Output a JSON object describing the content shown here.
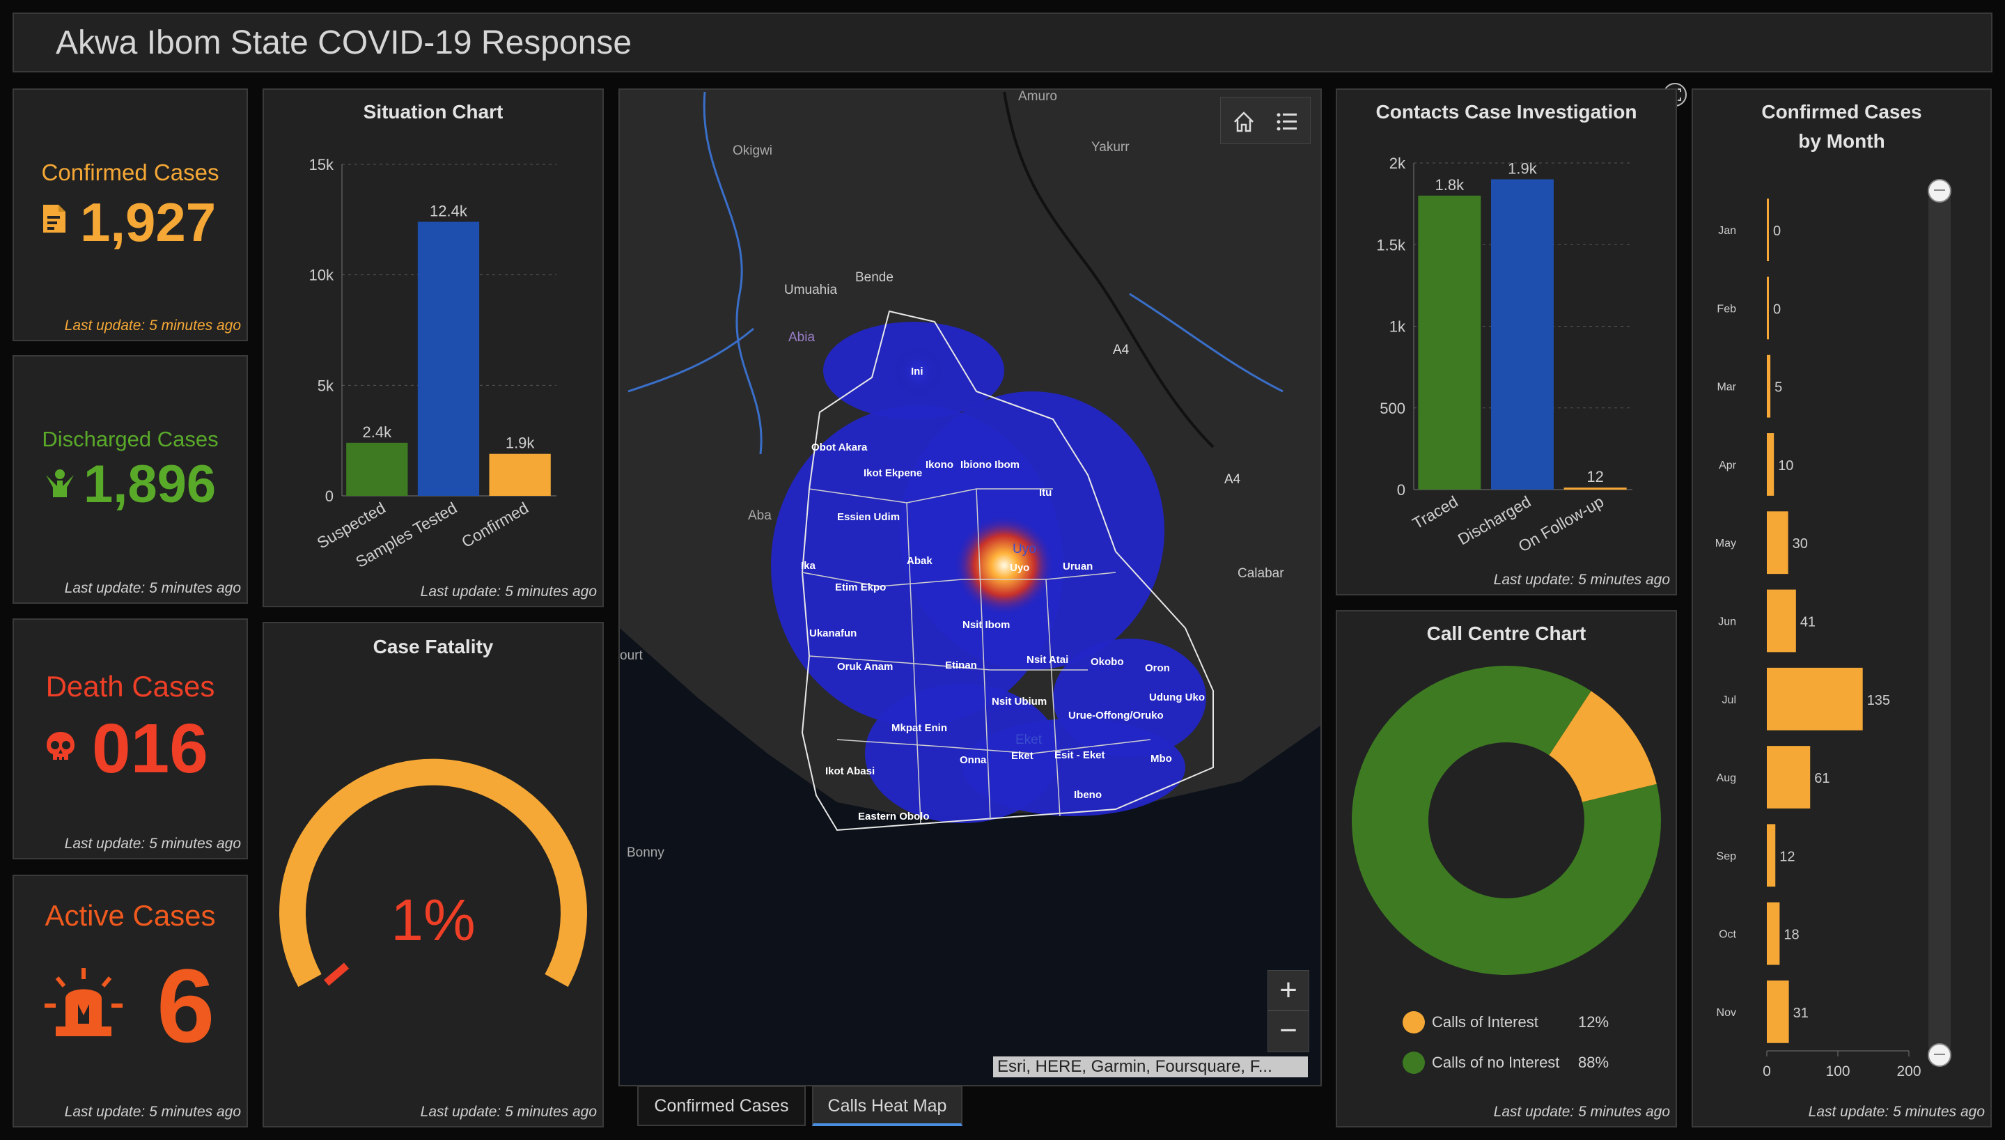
{
  "header": {
    "title": "Akwa Ibom State COVID-19 Response"
  },
  "cards": {
    "confirmed": {
      "label": "Confirmed Cases",
      "value": "1,927",
      "update": "Last update: 5 minutes ago",
      "color": "#f5a836",
      "icon": "document-icon"
    },
    "discharged": {
      "label": "Discharged Cases",
      "value": "1,896",
      "update": "Last update: 5 minutes ago",
      "color": "#5aaa2a",
      "icon": "people-icon"
    },
    "death": {
      "label": "Death Cases",
      "value": "016",
      "update": "Last update: 5 minutes ago",
      "color": "#ef3f26",
      "icon": "skull-icon"
    },
    "active": {
      "label": "Active Cases",
      "value": "6",
      "update": "Last update: 5 minutes ago",
      "color": "#f05a1e",
      "icon": "siren-icon"
    }
  },
  "situation": {
    "title": "Situation Chart",
    "update": "Last update: 5 minutes ago",
    "chart_data": {
      "type": "bar",
      "categories": [
        "Suspected",
        "Samples Tested",
        "Confirmed"
      ],
      "values": [
        2400,
        12400,
        1900
      ],
      "value_labels": [
        "2.4k",
        "12.4k",
        "1.9k"
      ],
      "colors": [
        "#3d7a22",
        "#1f4fae",
        "#f5a836"
      ],
      "yticks": [
        "15k",
        "10k",
        "5k",
        "0"
      ],
      "ylim": [
        0,
        15000
      ]
    }
  },
  "fatality": {
    "title": "Case Fatality",
    "value": "1%",
    "update": "Last update: 5 minutes ago",
    "fraction": 0.01,
    "color": "#f5a836",
    "marker_color": "#ef3f26"
  },
  "map": {
    "attribution": "Esri, HERE, Garmin, Foursquare, F...",
    "places": [
      "Amuro",
      "Okigwi",
      "Yakurr",
      "Umuahia",
      "Bende",
      "Abia",
      "A4",
      "A4",
      "Aba",
      "Calabar",
      "ourt",
      "Bonny",
      "Ini",
      "Obot Akara",
      "Ikono",
      "Ikot Ekpene",
      "Ibiono Ibom",
      "Itu",
      "Essien Udim",
      "Ika",
      "Abak",
      "Uyo",
      "Uruan",
      "Etim Ekpo",
      "Nsit Ibom",
      "Ukanafun",
      "Oruk Anam",
      "Etinan",
      "Nsit Atai",
      "Okobo",
      "Oron",
      "Udung Uko",
      "Nsit Ubium",
      "Urue-Offong/Oruko",
      "Mkpat Enin",
      "Eket",
      "Esit - Eket",
      "Onna",
      "Mbo",
      "Ikot Abasi",
      "Ibeno",
      "Eastern Obolo",
      "Uyo",
      "Eket"
    ],
    "zoom_in": "+",
    "zoom_out": "−"
  },
  "tabs": {
    "confirmed": "Confirmed Cases",
    "heatmap": "Calls Heat Map"
  },
  "contacts": {
    "title": "Contacts Case Investigation",
    "update": "Last update: 5 minutes ago",
    "chart_data": {
      "type": "bar",
      "categories": [
        "Traced",
        "Discharged",
        "On Follow-up"
      ],
      "values": [
        1800,
        1900,
        12
      ],
      "value_labels": [
        "1.8k",
        "1.9k",
        "12"
      ],
      "colors": [
        "#3d7a22",
        "#1f4fae",
        "#f5a836"
      ],
      "yticks": [
        "2k",
        "1.5k",
        "1k",
        "500",
        "0"
      ],
      "ylim": [
        0,
        2000
      ]
    }
  },
  "callcentre": {
    "title": "Call Centre Chart",
    "update": "Last update: 5 minutes ago",
    "chart_data": {
      "type": "pie",
      "labels": [
        "Calls of Interest",
        "Calls of no Interest"
      ],
      "values": [
        12,
        88
      ],
      "percents": [
        "12%",
        "88%"
      ],
      "colors": [
        "#f5a836",
        "#3d7a22"
      ]
    }
  },
  "monthly": {
    "title_line1": "Confirmed Cases",
    "title_line2": "by Month",
    "update": "Last update: 5 minutes ago",
    "chart_data": {
      "type": "bar",
      "categories": [
        "Jan",
        "Feb",
        "Mar",
        "Apr",
        "May",
        "Jun",
        "Jul",
        "Aug",
        "Sep",
        "Oct",
        "Nov"
      ],
      "values": [
        0,
        0,
        5,
        10,
        30,
        41,
        135,
        61,
        12,
        18,
        31
      ],
      "xticks": [
        "0",
        "100",
        "200"
      ],
      "xlim": [
        0,
        200
      ],
      "color": "#f5a836"
    }
  }
}
